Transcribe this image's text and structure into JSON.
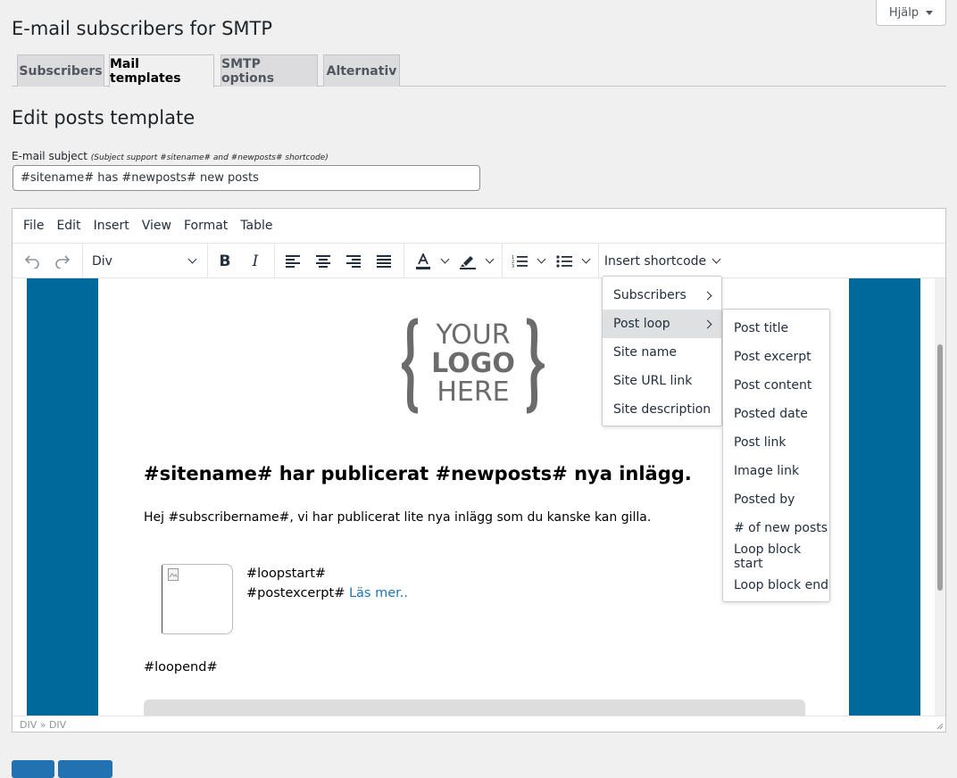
{
  "help": {
    "label": "Hjälp"
  },
  "page": {
    "title": "E-mail subscribers for SMTP"
  },
  "tabs": [
    {
      "label": "Subscribers"
    },
    {
      "label": "Mail templates"
    },
    {
      "label": "SMTP options"
    },
    {
      "label": "Alternativ"
    }
  ],
  "section": {
    "title": "Edit posts template"
  },
  "subject": {
    "label": "E-mail subject",
    "hint": "(Subject support #sitename# and #newposts# shortcode)",
    "value": "#sitename# has #newposts# new posts"
  },
  "menubar": [
    "File",
    "Edit",
    "Insert",
    "View",
    "Format",
    "Table"
  ],
  "toolbar": {
    "block_format": "Div",
    "shortcode_label": "Insert shortcode"
  },
  "logo": {
    "line1": "YOUR",
    "line2": "LOGO",
    "line3": "HERE"
  },
  "email": {
    "heading": "#sitename# har publicerat #newposts# nya inlägg.",
    "intro": "Hej #subscribername#, vi har publicerat lite nya inlägg som du kanske kan gilla.",
    "loopstart": "#loopstart#",
    "postexcerpt": "#postexcerpt#",
    "readmore": "Läs mer..",
    "loopend": "#loopend#"
  },
  "status": {
    "path": "DIV » DIV"
  },
  "shortcode_menu": [
    {
      "label": "Subscribers"
    },
    {
      "label": "Post loop"
    },
    {
      "label": "Site name"
    },
    {
      "label": "Site URL link"
    },
    {
      "label": "Site description"
    }
  ],
  "post_loop_menu": [
    {
      "label": "Post title"
    },
    {
      "label": "Post excerpt"
    },
    {
      "label": "Post content"
    },
    {
      "label": "Posted date"
    },
    {
      "label": "Post link"
    },
    {
      "label": "Image link"
    },
    {
      "label": "Posted by"
    },
    {
      "label": "# of new posts"
    },
    {
      "label": "Loop block start"
    },
    {
      "label": "Loop block end"
    }
  ],
  "colors": {
    "accent": "#00699c",
    "link": "#1a75b9",
    "button": "#2271b1"
  }
}
